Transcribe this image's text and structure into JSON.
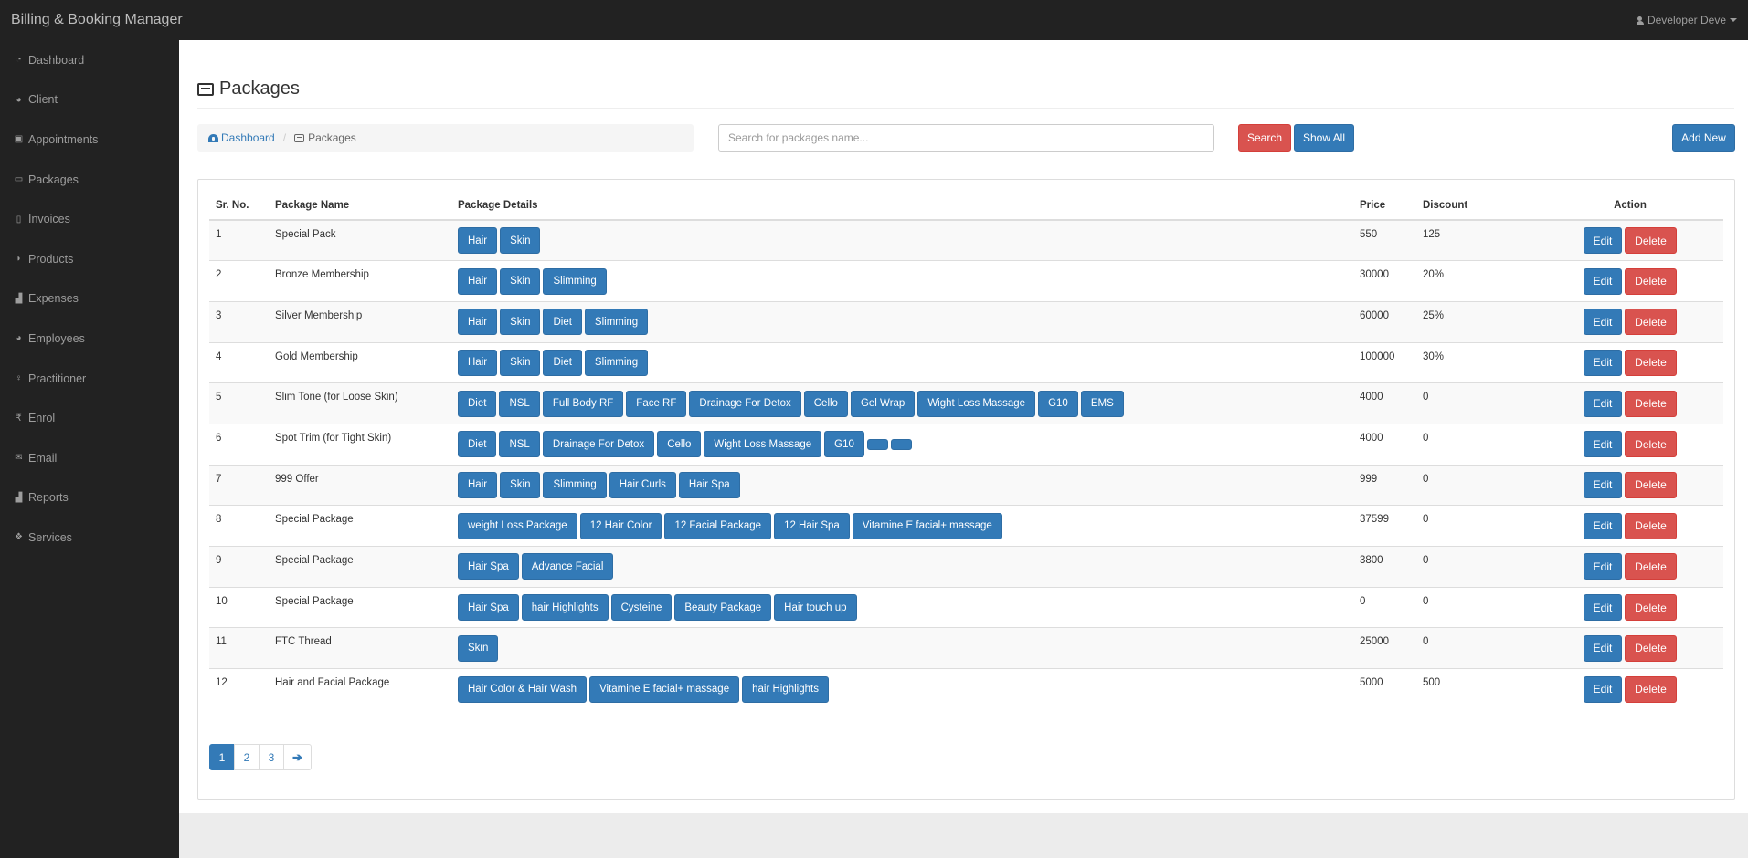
{
  "app": {
    "brand": "Billing & Booking Manager",
    "user": "Developer Deve"
  },
  "sidebar": {
    "items": [
      {
        "label": "Dashboard",
        "icon": "dashboard-icon",
        "glyph": "◔"
      },
      {
        "label": "Client",
        "icon": "users-icon",
        "glyph": "◕"
      },
      {
        "label": "Appointments",
        "icon": "briefcase-icon",
        "glyph": "▣"
      },
      {
        "label": "Packages",
        "icon": "inbox-icon",
        "glyph": "▭"
      },
      {
        "label": "Invoices",
        "icon": "file-icon",
        "glyph": "▯"
      },
      {
        "label": "Products",
        "icon": "shield-icon",
        "glyph": "◗"
      },
      {
        "label": "Expenses",
        "icon": "bar-chart-icon",
        "glyph": "▟"
      },
      {
        "label": "Employees",
        "icon": "users-icon",
        "glyph": "◕"
      },
      {
        "label": "Practitioner",
        "icon": "female-icon",
        "glyph": "♀"
      },
      {
        "label": "Enrol",
        "icon": "rupee-icon",
        "glyph": "₹"
      },
      {
        "label": "Email",
        "icon": "envelope-icon",
        "glyph": "✉"
      },
      {
        "label": "Reports",
        "icon": "bar-chart-icon",
        "glyph": "▟"
      },
      {
        "label": "Services",
        "icon": "cubes-icon",
        "glyph": "❖"
      }
    ]
  },
  "page": {
    "title": "Packages",
    "breadcrumb": {
      "home": "Dashboard",
      "current": "Packages"
    },
    "search": {
      "placeholder": "Search for packages name...",
      "value": ""
    },
    "search_button": "Search",
    "show_all_button": "Show All",
    "add_new_button": "Add New"
  },
  "table": {
    "headers": {
      "no": "Sr. No.",
      "name": "Package Name",
      "details": "Package Details",
      "price": "Price",
      "discount": "Discount",
      "action": "Action"
    },
    "edit_label": "Edit",
    "delete_label": "Delete",
    "rows": [
      {
        "no": "1",
        "name": "Special Pack",
        "details": [
          "Hair",
          "Skin"
        ],
        "price": "550",
        "discount": "125"
      },
      {
        "no": "2",
        "name": "Bronze Membership",
        "details": [
          "Hair",
          "Skin",
          "Slimming"
        ],
        "price": "30000",
        "discount": "20%"
      },
      {
        "no": "3",
        "name": "Silver Membership",
        "details": [
          "Hair",
          "Skin",
          "Diet",
          "Slimming"
        ],
        "price": "60000",
        "discount": "25%"
      },
      {
        "no": "4",
        "name": "Gold Membership",
        "details": [
          "Hair",
          "Skin",
          "Diet",
          "Slimming"
        ],
        "price": "100000",
        "discount": "30%"
      },
      {
        "no": "5",
        "name": "Slim Tone (for Loose Skin)",
        "details": [
          "Diet",
          "NSL",
          "Full Body RF",
          "Face RF",
          "Drainage For Detox",
          "Cello",
          "Gel Wrap",
          "Wight Loss Massage",
          "G10",
          "EMS"
        ],
        "price": "4000",
        "discount": "0"
      },
      {
        "no": "6",
        "name": "Spot Trim (for Tight Skin)",
        "details": [
          "Diet",
          "NSL",
          "Drainage For Detox",
          "Cello",
          "Wight Loss Massage",
          "G10",
          "",
          ""
        ],
        "price": "4000",
        "discount": "0"
      },
      {
        "no": "7",
        "name": "999 Offer",
        "details": [
          "Hair",
          "Skin",
          "Slimming",
          "Hair Curls",
          "Hair Spa"
        ],
        "price": "999",
        "discount": "0"
      },
      {
        "no": "8",
        "name": "Special Package",
        "details": [
          "weight Loss Package",
          "12 Hair Color",
          "12 Facial Package",
          "12 Hair Spa",
          "Vitamine E facial+ massage"
        ],
        "price": "37599",
        "discount": "0"
      },
      {
        "no": "9",
        "name": "Special Package",
        "details": [
          "Hair Spa",
          "Advance Facial"
        ],
        "price": "3800",
        "discount": "0"
      },
      {
        "no": "10",
        "name": "Special Package",
        "details": [
          "Hair Spa",
          "hair Highlights",
          "Cysteine",
          "Beauty Package",
          "Hair touch up"
        ],
        "price": "0",
        "discount": "0"
      },
      {
        "no": "11",
        "name": "FTC Thread",
        "details": [
          "Skin"
        ],
        "price": "25000",
        "discount": "0"
      },
      {
        "no": "12",
        "name": "Hair and Facial Package",
        "details": [
          "Hair Color & Hair Wash",
          "Vitamine E facial+ massage",
          "hair Highlights"
        ],
        "price": "5000",
        "discount": "500"
      }
    ]
  },
  "pagination": {
    "pages": [
      "1",
      "2",
      "3"
    ],
    "active": "1",
    "next_icon": "arrow-right-icon",
    "next_glyph": "🡒"
  },
  "colors": {
    "primary": "#337ab7",
    "danger": "#d9534f",
    "navbar": "#222222"
  }
}
